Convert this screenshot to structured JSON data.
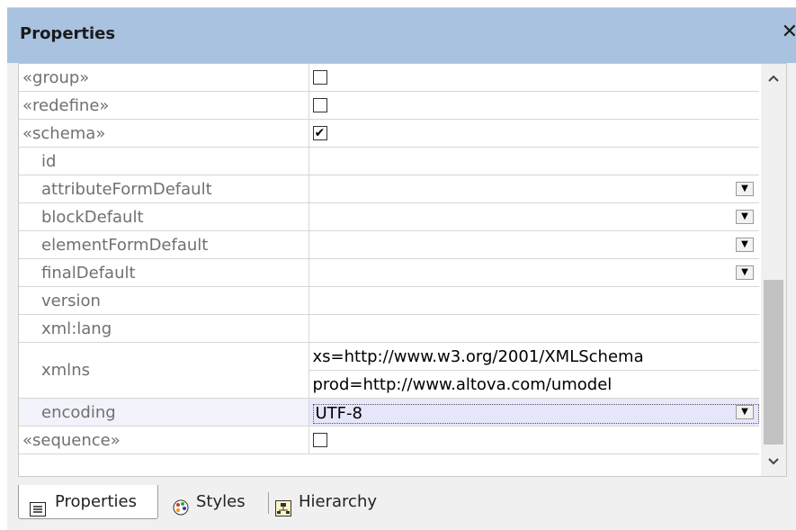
{
  "window": {
    "title": "Properties",
    "close_glyph": "✕"
  },
  "properties": [
    {
      "name": "«group»",
      "type": "checkbox",
      "checked": false,
      "indent": 0
    },
    {
      "name": "«redefine»",
      "type": "checkbox",
      "checked": false,
      "indent": 0
    },
    {
      "name": "«schema»",
      "type": "checkbox",
      "checked": true,
      "indent": 0
    },
    {
      "name": "id",
      "type": "text",
      "value": "",
      "indent": 1
    },
    {
      "name": "attributeFormDefault",
      "type": "dropdown",
      "value": "",
      "indent": 1
    },
    {
      "name": "blockDefault",
      "type": "dropdown",
      "value": "",
      "indent": 1
    },
    {
      "name": "elementFormDefault",
      "type": "dropdown",
      "value": "",
      "indent": 1
    },
    {
      "name": "finalDefault",
      "type": "dropdown",
      "value": "",
      "indent": 1
    },
    {
      "name": "version",
      "type": "text",
      "value": "",
      "indent": 1
    },
    {
      "name": "xml:lang",
      "type": "text",
      "value": "",
      "indent": 1
    },
    {
      "name": "xmlns",
      "type": "multi",
      "values": [
        "xs=http://www.w3.org/2001/XMLSchema",
        "prod=http://www.altova.com/umodel"
      ],
      "indent": 1
    },
    {
      "name": "encoding",
      "type": "dropdown",
      "value": "UTF-8",
      "indent": 1,
      "selected": true
    },
    {
      "name": "«sequence»",
      "type": "checkbox",
      "checked": false,
      "indent": 0
    }
  ],
  "tabs": [
    {
      "label": "Properties",
      "icon": "properties-list-icon",
      "active": true
    },
    {
      "label": "Styles",
      "icon": "palette-icon",
      "active": false
    },
    {
      "label": "Hierarchy",
      "icon": "hierarchy-icon",
      "active": false
    }
  ],
  "scrollbar": {
    "up_glyph": "^",
    "down_glyph": "v"
  },
  "colors": {
    "titlebar": "#a8c2df",
    "selected_row": "#e8e8fb"
  }
}
